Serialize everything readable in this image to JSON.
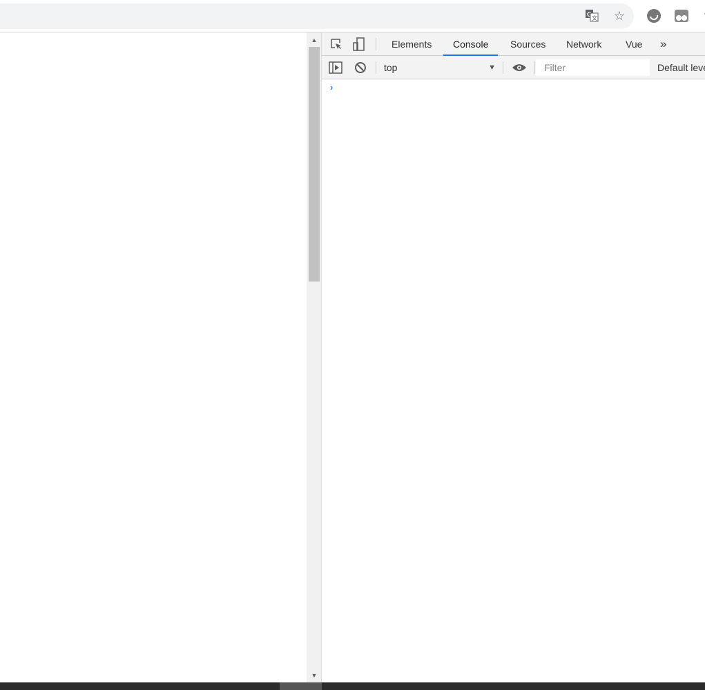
{
  "browser": {
    "icons": [
      "translate-icon",
      "bookmark-star-icon",
      "extension-icon",
      "extension-icon-2",
      "menu-icon"
    ]
  },
  "devtools": {
    "tabs": [
      {
        "label": "Elements"
      },
      {
        "label": "Console",
        "active": true
      },
      {
        "label": "Sources"
      },
      {
        "label": "Network"
      },
      {
        "label": "Vue"
      }
    ],
    "more_tabs": "»",
    "console": {
      "context": "top",
      "filter_placeholder": "Filter",
      "levels": "Default levels",
      "prompt": "›"
    }
  },
  "colors": {
    "accent": "#1a73e8",
    "prompt": "#367cf1"
  }
}
